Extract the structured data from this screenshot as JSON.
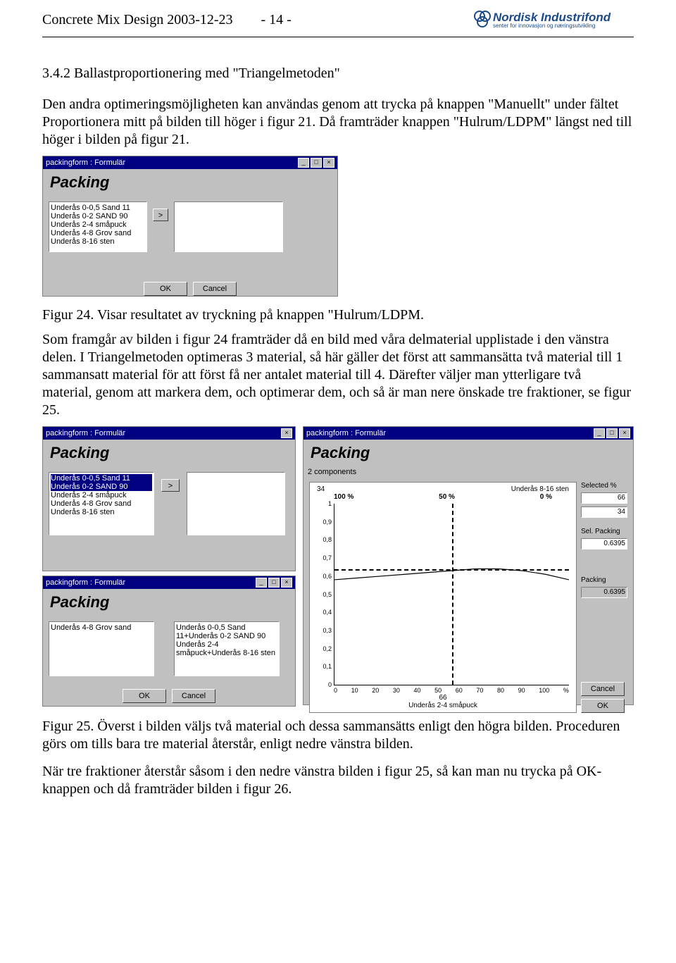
{
  "header": {
    "doc_title": "Concrete Mix Design 2003-12-23",
    "page_no": "- 14 -",
    "logo_title": "Nordisk Industrifond",
    "logo_sub": "senter for innovasjon og næringsutvikling"
  },
  "section_heading": "3.4.2 Ballastproportionering med \"Triangelmetoden\"",
  "para1": "Den andra optimeringsmöjligheten kan användas genom att trycka på knappen \"Manuellt\" under fältet Proportionera mitt på bilden till höger i figur 21. Då framträder knappen \"Hulrum/LDPM\" längst ned till höger i bilden på figur 21.",
  "fig24_caption": "Figur 24. Visar resultatet av tryckning på knappen \"Hulrum/LDPM.",
  "para2": "Som framgår av bilden i figur 24 framträder då en bild med våra delmaterial upplistade i den vänstra delen. I Triangelmetoden optimeras 3 material, så här gäller det först att sammansätta två material till 1 sammansatt material för att först få ner antalet material till 4. Därefter väljer man ytterligare två material, genom att markera dem, och optimerar dem, och så är man nere önskade tre fraktioner, se figur 25.",
  "fig25_caption": "Figur 25. Överst i bilden väljs två material och dessa sammansätts enligt den högra bilden. Proceduren görs om tills bara tre material återstår, enligt nedre vänstra bilden.",
  "para3": "När tre fraktioner återstår såsom i den nedre vänstra bilden i figur 25, så kan man nu trycka på OK-knappen och då framträder bilden i figur 26.",
  "window_title": "packingform : Formulär",
  "packing_label": "Packing",
  "components_label": "2 components",
  "buttons": {
    "ok": "OK",
    "cancel": "Cancel",
    "move": ">"
  },
  "list_fig24": [
    "Underås 0-0,5 Sand 11",
    "Underås 0-2 SAND 90",
    "Underås 2-4 småpuck",
    "Underås 4-8 Grov sand",
    "Underås 8-16 sten"
  ],
  "list_fig25a_left": [
    "Underås 0-0,5 Sand 11",
    "Underås 0-2 SAND 90",
    "Underås 2-4 småpuck",
    "Underås 4-8 Grov sand",
    "Underås 8-16 sten"
  ],
  "list_fig25a_selected_idx": [
    0,
    1
  ],
  "list_fig25c_left": [
    "Underås 4-8 Grov sand"
  ],
  "list_fig25c_right": [
    "Underås 0-0,5 Sand 11+Underås 0-2 SAND 90",
    "Underås 2-4 småpuck+Underås 8-16 sten"
  ],
  "chart_data": {
    "type": "line",
    "title_left": "34",
    "title_right": "Underås 8-16 sten",
    "top_scale": [
      "100 %",
      "50 %",
      "0 %"
    ],
    "x_axis_label_bottom": "Underås 2-4 småpuck",
    "x_bottom_indicator": "66",
    "x_ticks": [
      "0",
      "10",
      "20",
      "30",
      "40",
      "50",
      "60",
      "70",
      "80",
      "90",
      "100"
    ],
    "x_unit": "%",
    "y_ticks": [
      "1",
      "0,9",
      "0,8",
      "0,7",
      "0,6",
      "0,5",
      "0,4",
      "0,3",
      "0,2",
      "0,1",
      "0"
    ],
    "packing_curve": [
      0.58,
      0.59,
      0.6,
      0.61,
      0.62,
      0.63,
      0.64,
      0.64,
      0.63,
      0.61,
      0.58
    ],
    "dashed_h_value": 0.64,
    "dashed_v_x_percent": 50
  },
  "side": {
    "selected_label": "Selected %",
    "selected_vals": [
      "66",
      "34"
    ],
    "sel_packing_label": "Sel. Packing",
    "sel_packing_val": "0.6395",
    "packing_label": "Packing",
    "packing_val": "0.6395"
  }
}
